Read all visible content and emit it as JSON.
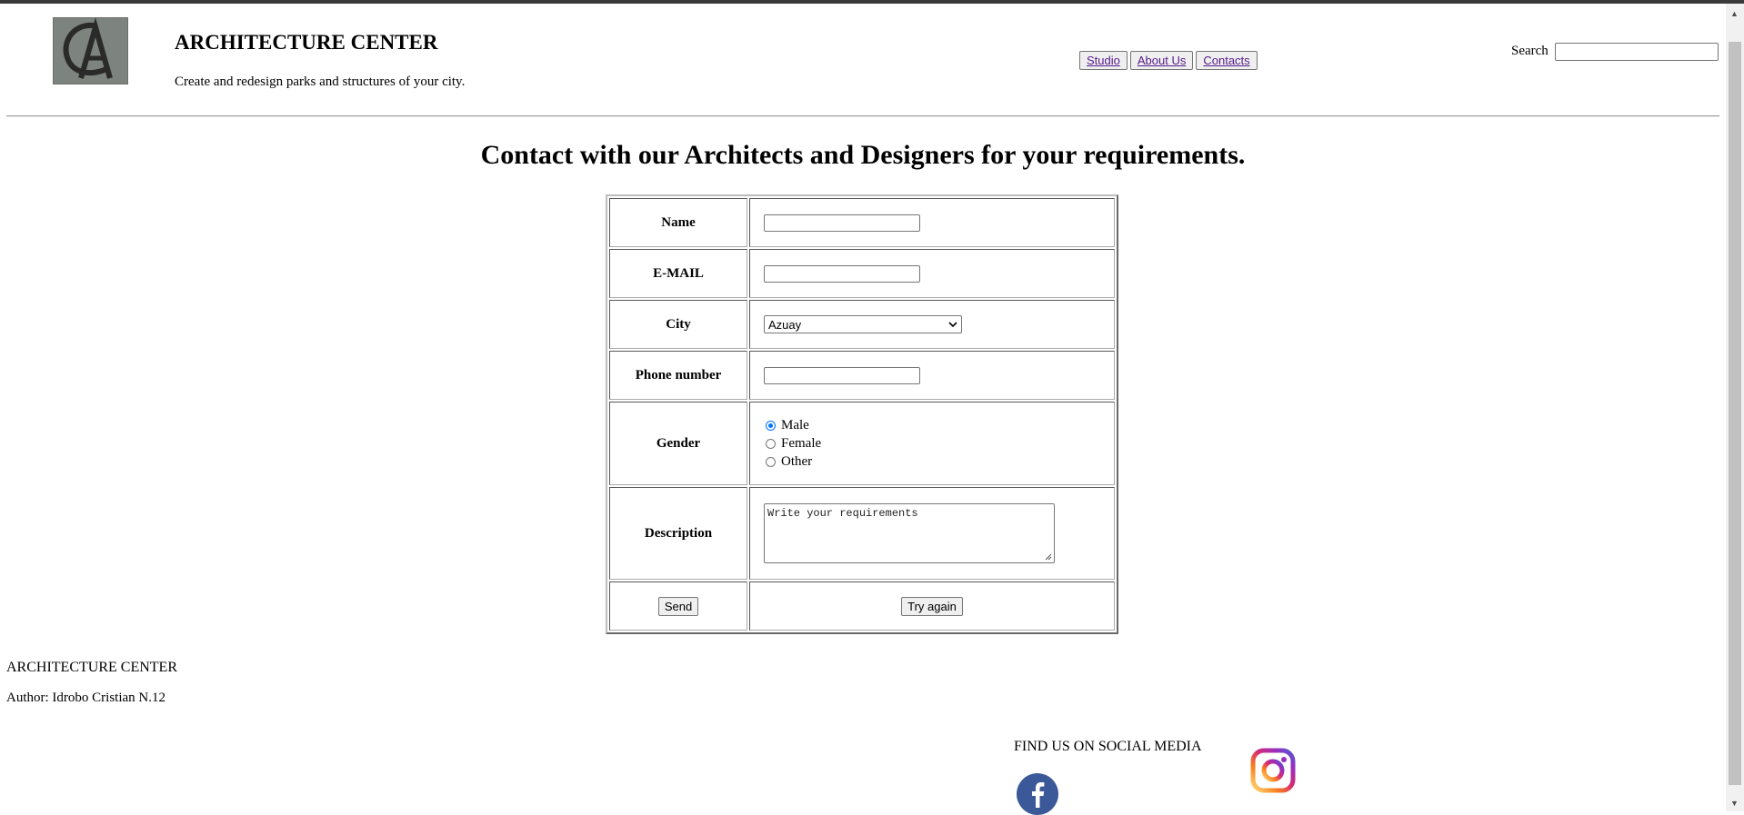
{
  "header": {
    "title": "ARCHITECTURE CENTER",
    "subtitle": "Create and redesign parks and structures of your city.",
    "nav": [
      "Studio",
      "About Us",
      "Contacts"
    ],
    "search_label": "Search",
    "search_value": ""
  },
  "main": {
    "heading": "Contact with our Architects and Designers for your requirements."
  },
  "form": {
    "name_label": "Name",
    "email_label": "E-MAIL",
    "city_label": "City",
    "city_selected": "Azuay",
    "phone_label": "Phone number",
    "gender_label": "Gender",
    "gender_options": [
      "Male",
      "Female",
      "Other"
    ],
    "gender_selected": "Male",
    "description_label": "Description",
    "description_value": "Write your requirements",
    "send_label": "Send",
    "reset_label": "Try again"
  },
  "footer": {
    "title": "ARCHITECTURE CENTER",
    "author": "Author: Idrobo Cristian N.12",
    "social_heading": "FIND US ON SOCIAL MEDIA",
    "social_icons": [
      "facebook-icon",
      "instagram-icon"
    ]
  },
  "colors": {
    "facebook": "#3b5998",
    "link": "#551a8b",
    "radio_selected": "#0075ff"
  }
}
